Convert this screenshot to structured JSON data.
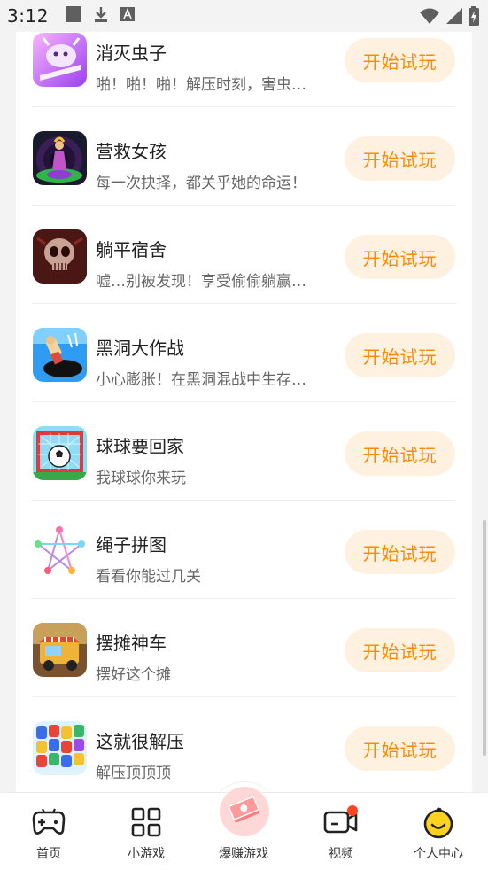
{
  "status_bar": {
    "time": "3:12"
  },
  "games": [
    {
      "title": "消灭虫子",
      "desc": "啪！啪！啪！解压时刻，害虫…",
      "button": "开始试玩",
      "icon": "bug-game-icon"
    },
    {
      "title": "营救女孩",
      "desc": "每一次抉择，都关乎她的命运！",
      "button": "开始试玩",
      "icon": "rescue-girl-icon"
    },
    {
      "title": "躺平宿舍",
      "desc": "嘘…别被发现！享受偷偷躺赢…",
      "button": "开始试玩",
      "icon": "dorm-skull-icon"
    },
    {
      "title": "黑洞大作战",
      "desc": "小心膨胀！在黑洞混战中生存…",
      "button": "开始试玩",
      "icon": "black-hole-icon"
    },
    {
      "title": "球球要回家",
      "desc": "我球球你来玩",
      "button": "开始试玩",
      "icon": "soccer-goal-icon"
    },
    {
      "title": "绳子拼图",
      "desc": "看看你能过几关",
      "button": "开始试玩",
      "icon": "rope-star-icon"
    },
    {
      "title": "摆摊神车",
      "desc": "摆好这个摊",
      "button": "开始试玩",
      "icon": "food-truck-icon"
    },
    {
      "title": "这就很解压",
      "desc": "解压顶顶顶",
      "button": "开始试玩",
      "icon": "color-blocks-icon"
    }
  ],
  "bottom_nav": [
    {
      "label": "首页",
      "icon": "gamepad-icon"
    },
    {
      "label": "小游戏",
      "icon": "grid-icon"
    },
    {
      "label": "爆赚游戏",
      "icon": "money-stack-icon"
    },
    {
      "label": "视频",
      "icon": "video-camera-icon"
    },
    {
      "label": "个人中心",
      "icon": "smiley-face-icon"
    }
  ],
  "colors": {
    "accent": "#ff8a00",
    "button_bg": "#fff1e0",
    "badge": "#ff4422"
  }
}
